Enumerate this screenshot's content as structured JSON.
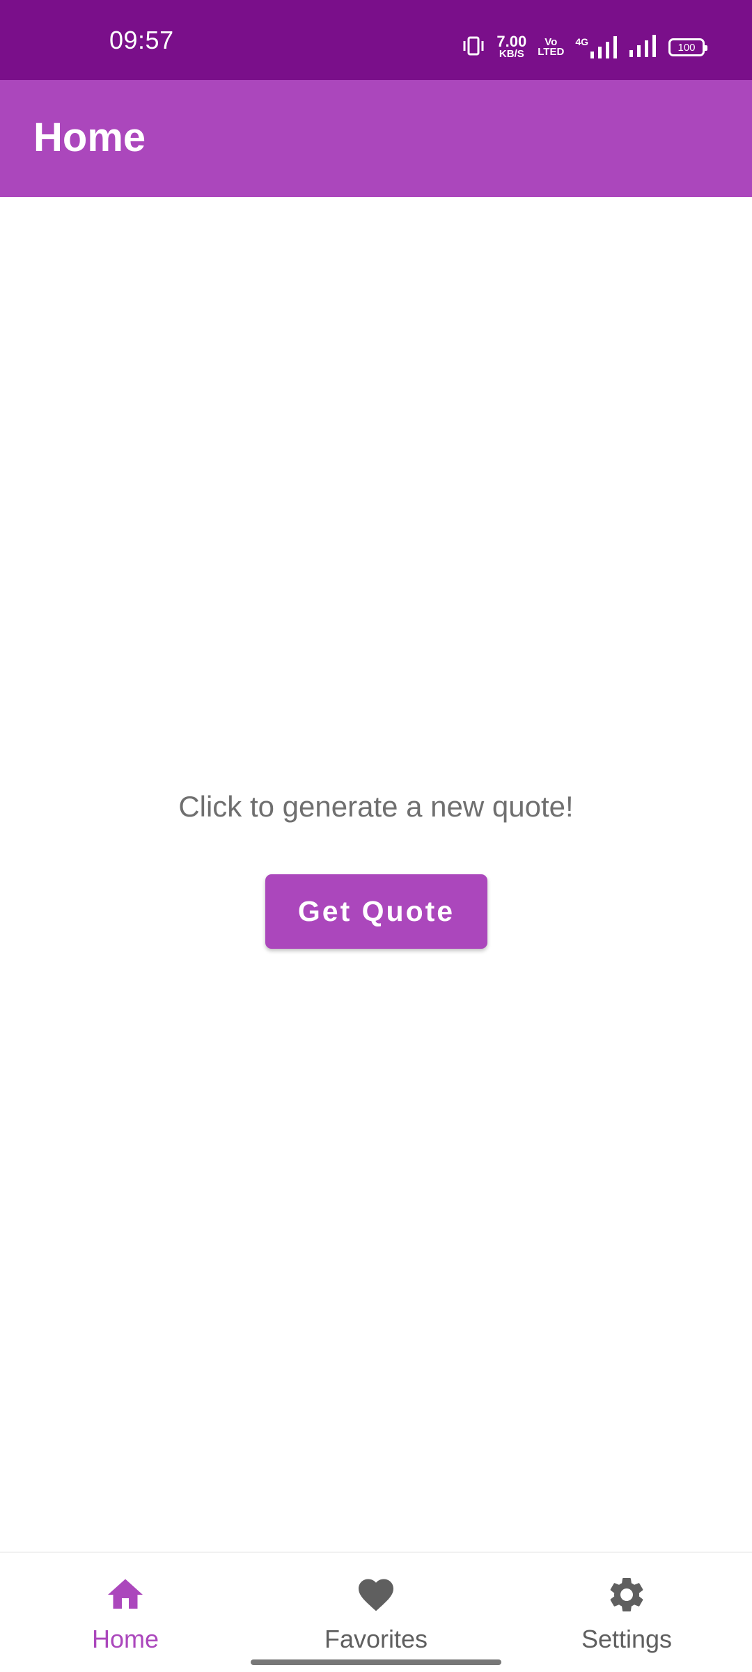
{
  "status_bar": {
    "time": "09:57",
    "network_speed_value": "7.00",
    "network_speed_unit": "KB/S",
    "volte_top": "Vo",
    "volte_bottom": "LTED",
    "network_type": "4G",
    "battery": "100",
    "icons": [
      "vibrate-icon",
      "network-speed",
      "volte-icon",
      "signal-4g-icon",
      "signal-icon",
      "battery-icon"
    ]
  },
  "app_bar": {
    "title": "Home",
    "color": "#ab47bc",
    "status_color": "#7a0f8a"
  },
  "main": {
    "prompt": "Click to generate a new quote!",
    "button_label": "Get Quote"
  },
  "bottom_nav": {
    "items": [
      {
        "label": "Home",
        "icon": "home-icon",
        "active": true
      },
      {
        "label": "Favorites",
        "icon": "heart-icon",
        "active": false
      },
      {
        "label": "Settings",
        "icon": "gear-icon",
        "active": false
      }
    ],
    "active_color": "#ab47bc",
    "inactive_color": "#5f5f5f"
  }
}
